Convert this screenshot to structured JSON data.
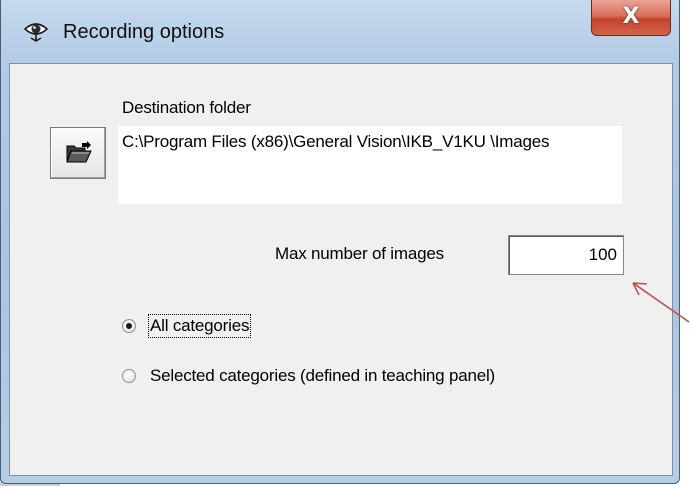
{
  "window": {
    "title": "Recording options",
    "close_glyph": "X",
    "icon": "eye-icon"
  },
  "destination": {
    "label": "Destination folder",
    "browse_icon": "open-folder-icon",
    "path": "C:\\Program Files (x86)\\General Vision\\IKB_V1KU \\Images"
  },
  "max_images": {
    "label": "Max number of images",
    "value": "100"
  },
  "categories": {
    "options": [
      {
        "label": "All categories",
        "checked": true
      },
      {
        "label": "Selected categories (defined in teaching panel)",
        "checked": false
      }
    ]
  },
  "annotation": {
    "arrow_color": "#c0504d"
  }
}
